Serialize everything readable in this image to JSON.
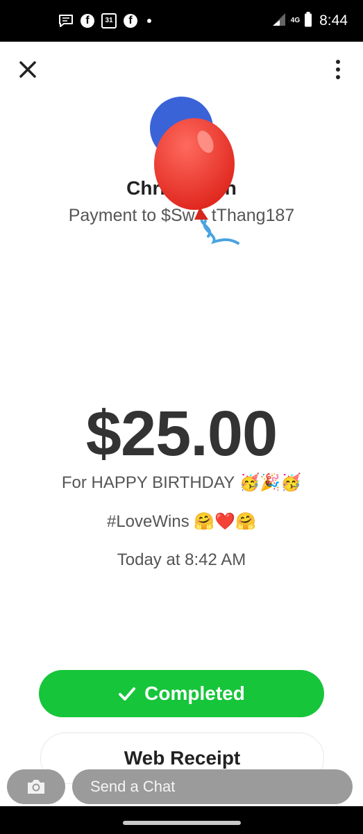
{
  "status_bar": {
    "time": "8:44",
    "network": "4G",
    "calendar_day": "31",
    "facebook_glyph": "f",
    "icons": [
      "chat-notification-icon",
      "facebook-icon",
      "calendar-icon",
      "facebook-icon",
      "more-dot-icon",
      "signal-icon",
      "battery-icon"
    ]
  },
  "header": {
    "close_icon": "close-icon",
    "more_icon": "more-vertical-icon"
  },
  "payment": {
    "recipient_name": "Chris",
    "recipient_name_end": "n",
    "payment_to": "Payment to $Sw",
    "payment_to_end": "tThang187",
    "amount": "$25.00",
    "note": "For HAPPY BIRTHDAY",
    "note_emoji": "🥳🎉🥳",
    "tags": "#LoveWins",
    "tags_emoji": "🤗❤️🤗",
    "timestamp": "Today at 8:42 AM"
  },
  "actions": {
    "completed_label": "Completed",
    "web_receipt_label": "Web Receipt"
  },
  "chat": {
    "placeholder": "Send a Chat"
  },
  "colors": {
    "accent_green": "#16c53a",
    "avatar_blue": "#3a63d8",
    "balloon_red": "#e8332a",
    "string_blue": "#4aa3e0"
  }
}
